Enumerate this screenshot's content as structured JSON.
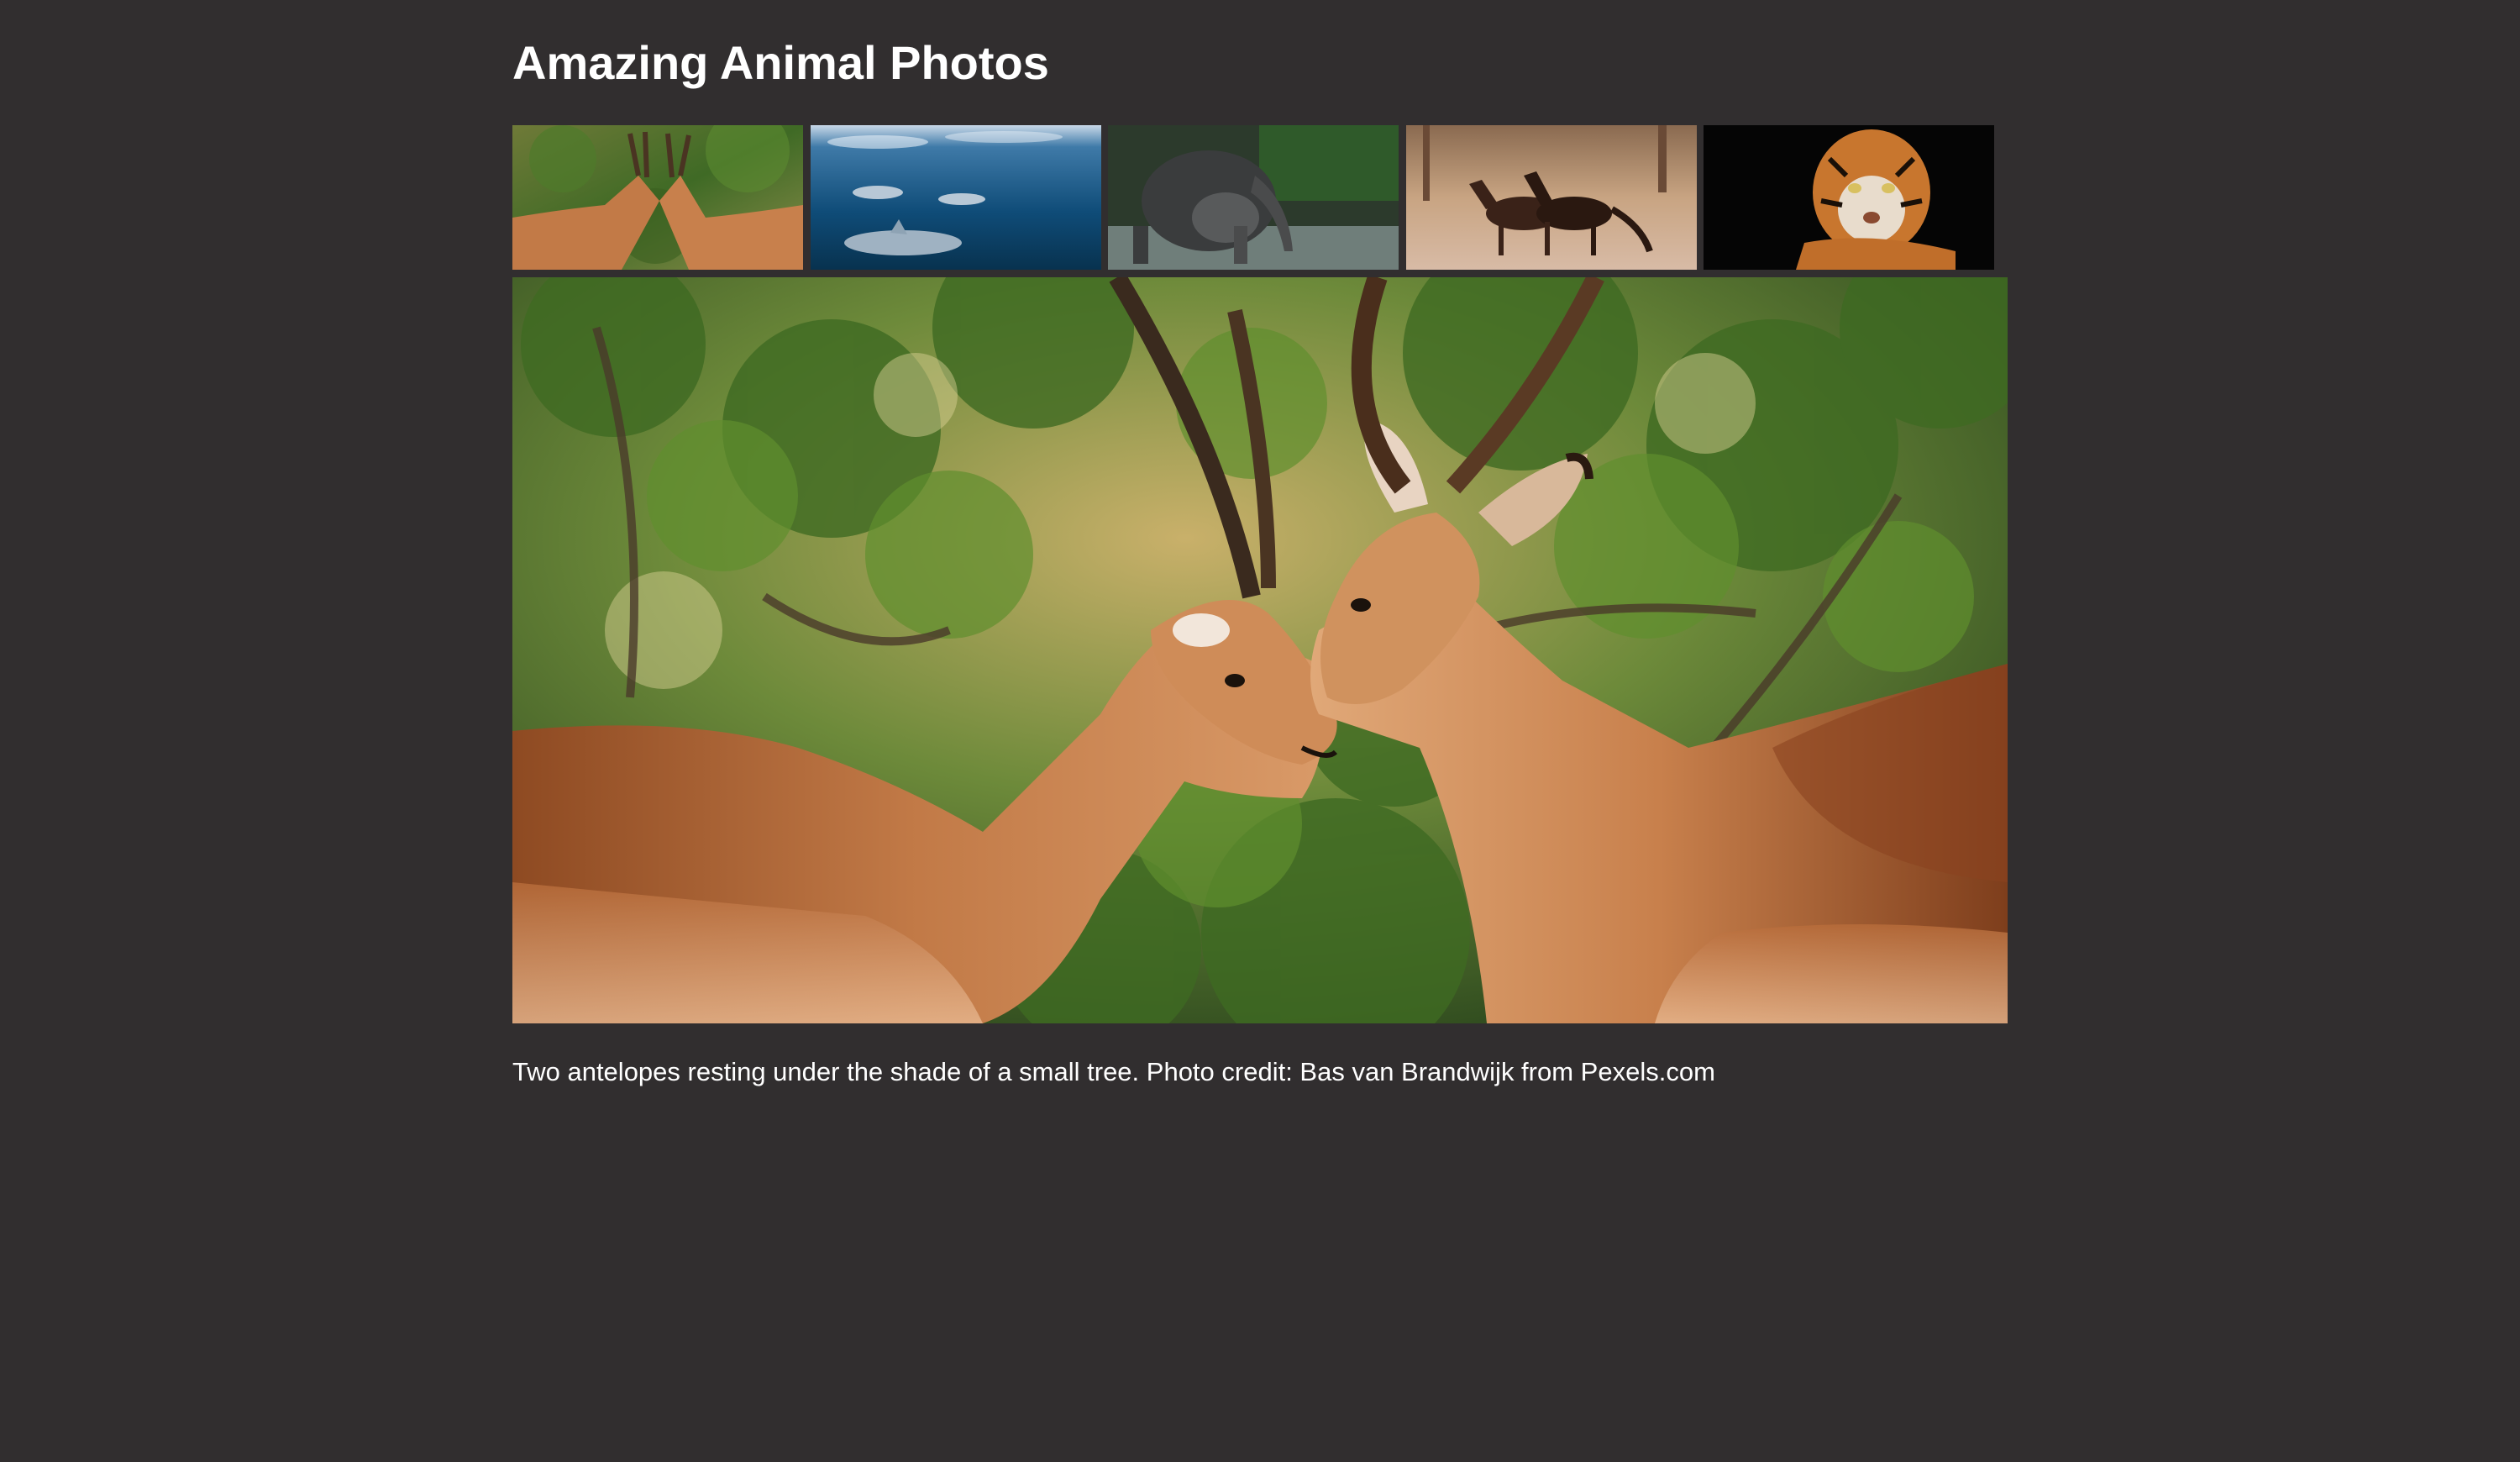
{
  "page": {
    "title": "Amazing Animal Photos",
    "background_color": "#312e2f",
    "text_color": "#ffffff"
  },
  "thumbnails": [
    {
      "subject": "antelopes",
      "icon": "antelope-thumbnail"
    },
    {
      "subject": "dolphins",
      "icon": "dolphin-thumbnail"
    },
    {
      "subject": "elephants",
      "icon": "elephant-thumbnail"
    },
    {
      "subject": "horses",
      "icon": "horse-thumbnail"
    },
    {
      "subject": "tiger",
      "icon": "tiger-thumbnail"
    }
  ],
  "selected_index": 0,
  "main_photo": {
    "subject": "antelopes",
    "icon": "antelope-photo"
  },
  "caption": "Two antelopes resting under the shade of a small tree. Photo credit: Bas van Brandwijk from Pexels.com"
}
